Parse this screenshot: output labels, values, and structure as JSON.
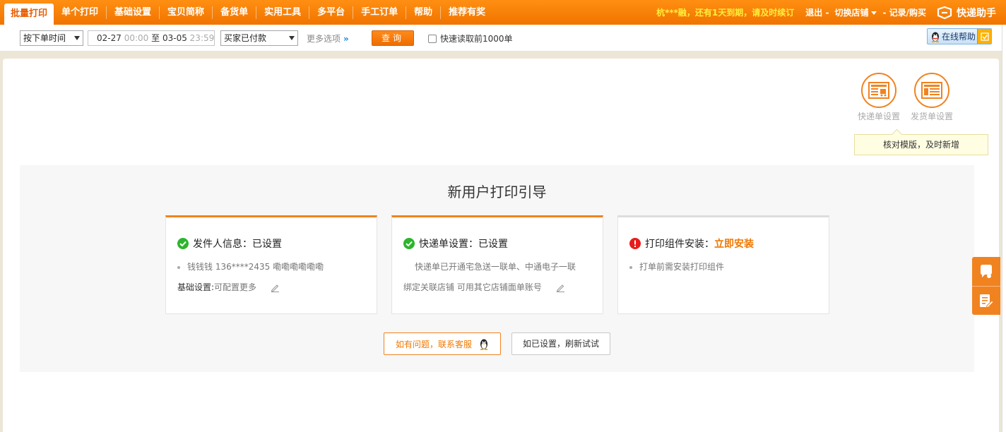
{
  "nav": {
    "items": [
      {
        "label": "批量打印",
        "active": true
      },
      {
        "label": "单个打印"
      },
      {
        "label": "基础设置"
      },
      {
        "label": "宝贝简称"
      },
      {
        "label": "备货单"
      },
      {
        "label": "实用工具"
      },
      {
        "label": "多平台"
      },
      {
        "label": "手工订单"
      },
      {
        "label": "帮助"
      },
      {
        "label": "推荐有奖"
      }
    ],
    "expire_notice": "杭***融，还有1天到期，请及时续订",
    "logout": "退出 -",
    "switch_shop": "切换店铺",
    "record_buy": "- 记录/购买",
    "brand": "快递助手"
  },
  "filter": {
    "time_select": "按下单时间",
    "date_start": "02-27",
    "time_start": "00:00",
    "to": "至",
    "date_end": "03-05",
    "time_end": "23:59",
    "status_select": "买家已付款",
    "more_options": "更多选项",
    "more_arrow": "»",
    "query": "查询",
    "quick_read": "快速读取前1000单",
    "online_help": "在线帮助"
  },
  "templates": {
    "express": "快递单设置",
    "delivery": "发货单设置",
    "tip": "核对模版，及时新增"
  },
  "guide": {
    "title": "新用户打印引导",
    "cards": [
      {
        "status": "ok",
        "title": "发件人信息：已设置",
        "line1": "钱钱钱 136****2435 嘞嘞嘞嘞嘞嘞",
        "line2_key": "基础设置:",
        "line2_val": "可配置更多"
      },
      {
        "status": "ok",
        "title": "快递单设置：已设置",
        "line1": "快递单已开通宅急送一联单、中通电子一联",
        "line2_val": "绑定关联店铺 可用其它店铺面单账号"
      },
      {
        "status": "error",
        "title": "打印组件安装：",
        "action": "立即安装",
        "line1": "打单前需安装打印组件"
      }
    ],
    "contact_button": "如有问题，联系客服",
    "refresh_button": "如已设置，刷新试试"
  },
  "colors": {
    "accent": "#f08320",
    "nav_bg": "#ff8a00",
    "expire": "#ffee3a",
    "ok": "#2db52d",
    "error": "#e81c1c"
  }
}
